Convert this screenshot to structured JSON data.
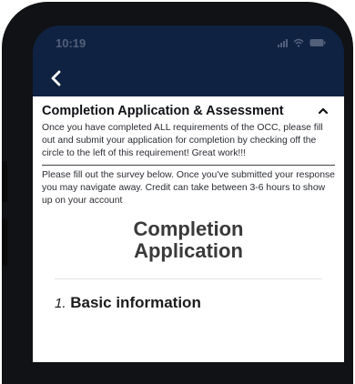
{
  "status_bar": {
    "time": "10:19"
  },
  "section": {
    "title": "Completion Application & Assessment",
    "intro": "Once you have completed ALL requirements of the OCC, please fill out and submit your application for completion by checking off the circle to the left of this requirement! Great work!!!",
    "survey_note": "Please fill out the survey below. Once you've submitted your response you may navigate away. Credit can take between 3-6 hours to show up on your account"
  },
  "form": {
    "title_line1": "Completion",
    "title_line2": "Application",
    "question_number": "1.",
    "question_label": "Basic information"
  },
  "colors": {
    "nav_bg": "#0f2242",
    "content_bg": "#ffffff"
  }
}
